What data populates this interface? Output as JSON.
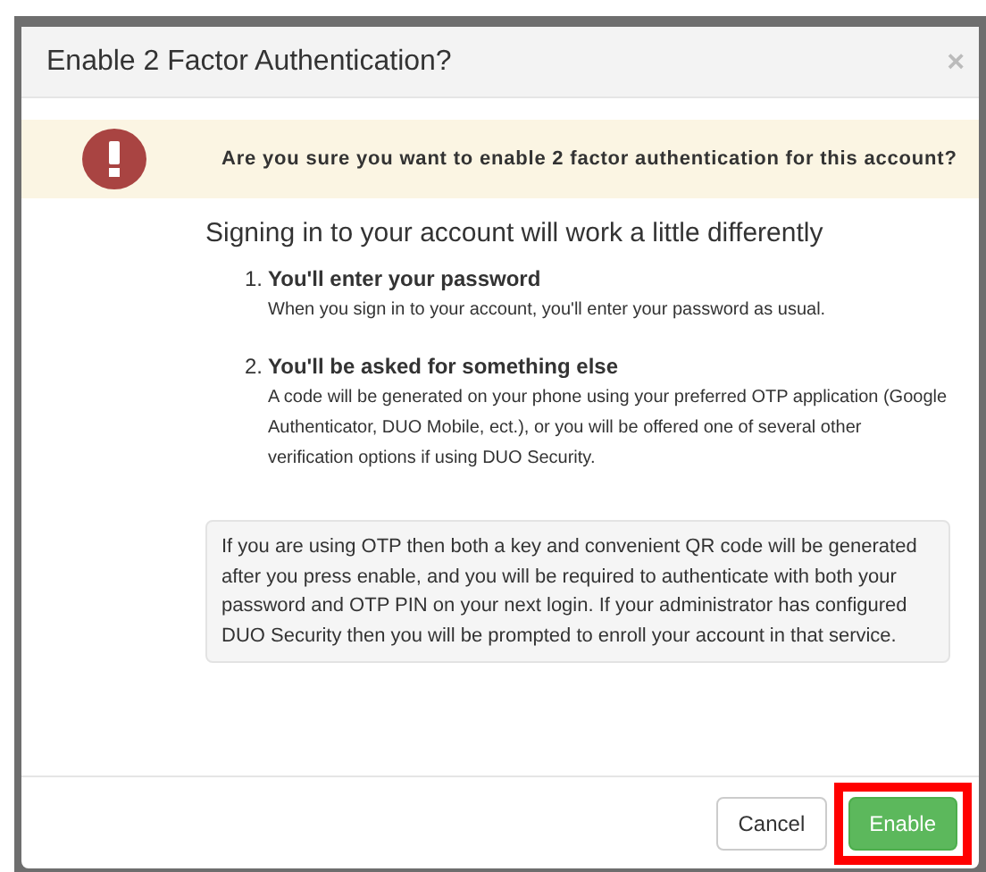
{
  "dialog": {
    "title": "Enable 2 Factor Authentication?",
    "close": "×"
  },
  "warning": {
    "text": "Are you sure you want to enable 2 factor authentication for this account?"
  },
  "heading": "Signing in to your account will work a little differently",
  "steps": [
    {
      "number": "1.",
      "title": "You'll enter your password",
      "text": "When you sign in to your account, you'll enter your password as usual."
    },
    {
      "number": "2.",
      "title": "You'll be asked for something else",
      "text": "A code will be generated on your phone using your preferred OTP application (Google Authenticator, DUO Mobile, ect.), or you will be offered one of several other verification options if using DUO Security."
    }
  ],
  "note": "If you are using OTP then both a key and convenient QR code will be generated after you press enable, and you will be required to authenticate with both your password and OTP PIN on your next login. If your administrator has configured DUO Security then you will be prompted to enroll your account in that service.",
  "buttons": [
    {
      "label": "Cancel",
      "kind": "default",
      "highlighted": false
    },
    {
      "label": "Enable",
      "kind": "primary",
      "highlighted": true
    }
  ]
}
